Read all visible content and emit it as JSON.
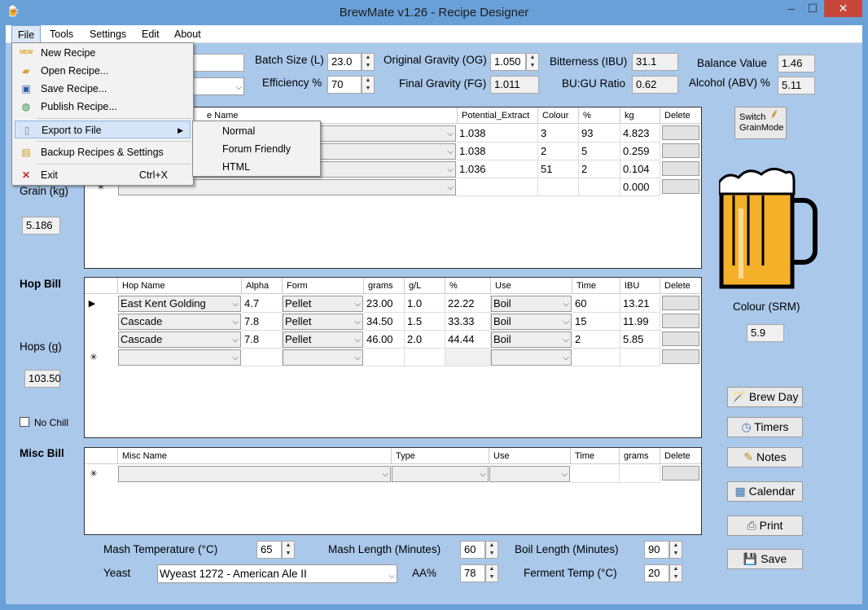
{
  "window": {
    "title": "BrewMate v1.26 - Recipe Designer",
    "min": "–",
    "max": "☐",
    "close": "✕"
  },
  "menubar": {
    "file": "File",
    "tools": "Tools",
    "settings": "Settings",
    "edit": "Edit",
    "about": "About"
  },
  "file_menu": {
    "new_recipe": "New Recipe",
    "open_recipe": "Open Recipe...",
    "save_recipe": "Save Recipe...",
    "publish_recipe": "Publish Recipe...",
    "export": "Export to File",
    "backup": "Backup Recipes & Settings",
    "exit": "Exit",
    "exit_shortcut": "Ctrl+X"
  },
  "export_menu": {
    "normal": "Normal",
    "forum": "Forum Friendly",
    "html": "HTML"
  },
  "params": {
    "batch_label": "Batch Size (L)",
    "batch": "23.0",
    "efficiency_label": "Efficiency %",
    "efficiency": "70",
    "og_label": "Original Gravity (OG)",
    "og": "1.050",
    "fg_label": "Final Gravity (FG)",
    "fg": "1.011",
    "ibu_label": "Bitterness (IBU)",
    "ibu": "31.1",
    "bugu_label": "BU:GU Ratio",
    "bugu": "0.62",
    "balance_label": "Balance Value",
    "balance": "1.46",
    "abv_label": "Alcohol (ABV) %",
    "abv": "5.11"
  },
  "grain": {
    "total_label": "Grain (kg)",
    "total": "5.186",
    "headers": {
      "name": "e Name",
      "extract": "Potential_Extract",
      "colour": "Colour",
      "pct": "%",
      "kg": "kg",
      "delete": "Delete"
    },
    "rows": [
      {
        "extract": "1.038",
        "colour": "3",
        "pct": "93",
        "kg": "4.823"
      },
      {
        "extract": "1.038",
        "colour": "2",
        "pct": "5",
        "kg": "0.259"
      },
      {
        "extract": "1.036",
        "colour": "51",
        "pct": "2",
        "kg": "0.104"
      }
    ],
    "new_row_kg": "0.000",
    "new_row_marker": "✳"
  },
  "switch_btn": {
    "line1": "Switch",
    "line2": "GrainMode"
  },
  "colour": {
    "label": "Colour (SRM)",
    "value": "5.9",
    "beer_color": "#f5b02a"
  },
  "hops": {
    "section": "Hop Bill",
    "total_label": "Hops (g)",
    "total": "103.50",
    "nochill": "No Chill",
    "headers": {
      "name": "Hop Name",
      "alpha": "Alpha",
      "form": "Form",
      "grams": "grams",
      "gl": "g/L",
      "pct": "%",
      "use": "Use",
      "time": "Time",
      "ibu": "IBU",
      "delete": "Delete"
    },
    "rows": [
      {
        "marker": "▶",
        "name": "East Kent Golding",
        "alpha": "4.7",
        "form": "Pellet",
        "grams": "23.00",
        "gl": "1.0",
        "pct": "22.22",
        "use": "Boil",
        "time": "60",
        "ibu": "13.21"
      },
      {
        "marker": "",
        "name": "Cascade",
        "alpha": "7.8",
        "form": "Pellet",
        "grams": "34.50",
        "gl": "1.5",
        "pct": "33.33",
        "use": "Boil",
        "time": "15",
        "ibu": "11.99"
      },
      {
        "marker": "",
        "name": "Cascade",
        "alpha": "7.8",
        "form": "Pellet",
        "grams": "46.00",
        "gl": "2.0",
        "pct": "44.44",
        "use": "Boil",
        "time": "2",
        "ibu": "5.85"
      }
    ],
    "new_row_marker": "✳"
  },
  "misc": {
    "section": "Misc Bill",
    "headers": {
      "name": "Misc Name",
      "type": "Type",
      "use": "Use",
      "time": "Time",
      "grams": "grams",
      "delete": "Delete"
    },
    "new_row_marker": "✳"
  },
  "buttons": {
    "brewday": "Brew Day",
    "timers": "Timers",
    "notes": "Notes",
    "calendar": "Calendar",
    "print": "Print",
    "save": "Save"
  },
  "bottom": {
    "mash_temp_label": "Mash Temperature (°C)",
    "mash_temp": "65",
    "mash_len_label": "Mash Length (Minutes)",
    "mash_len": "60",
    "boil_len_label": "Boil Length (Minutes)",
    "boil_len": "90",
    "yeast_label": "Yeast",
    "yeast": "Wyeast 1272 - American Ale II",
    "aa_label": "AA%",
    "aa": "78",
    "ferment_label": "Ferment Temp (°C)",
    "ferment": "20"
  }
}
